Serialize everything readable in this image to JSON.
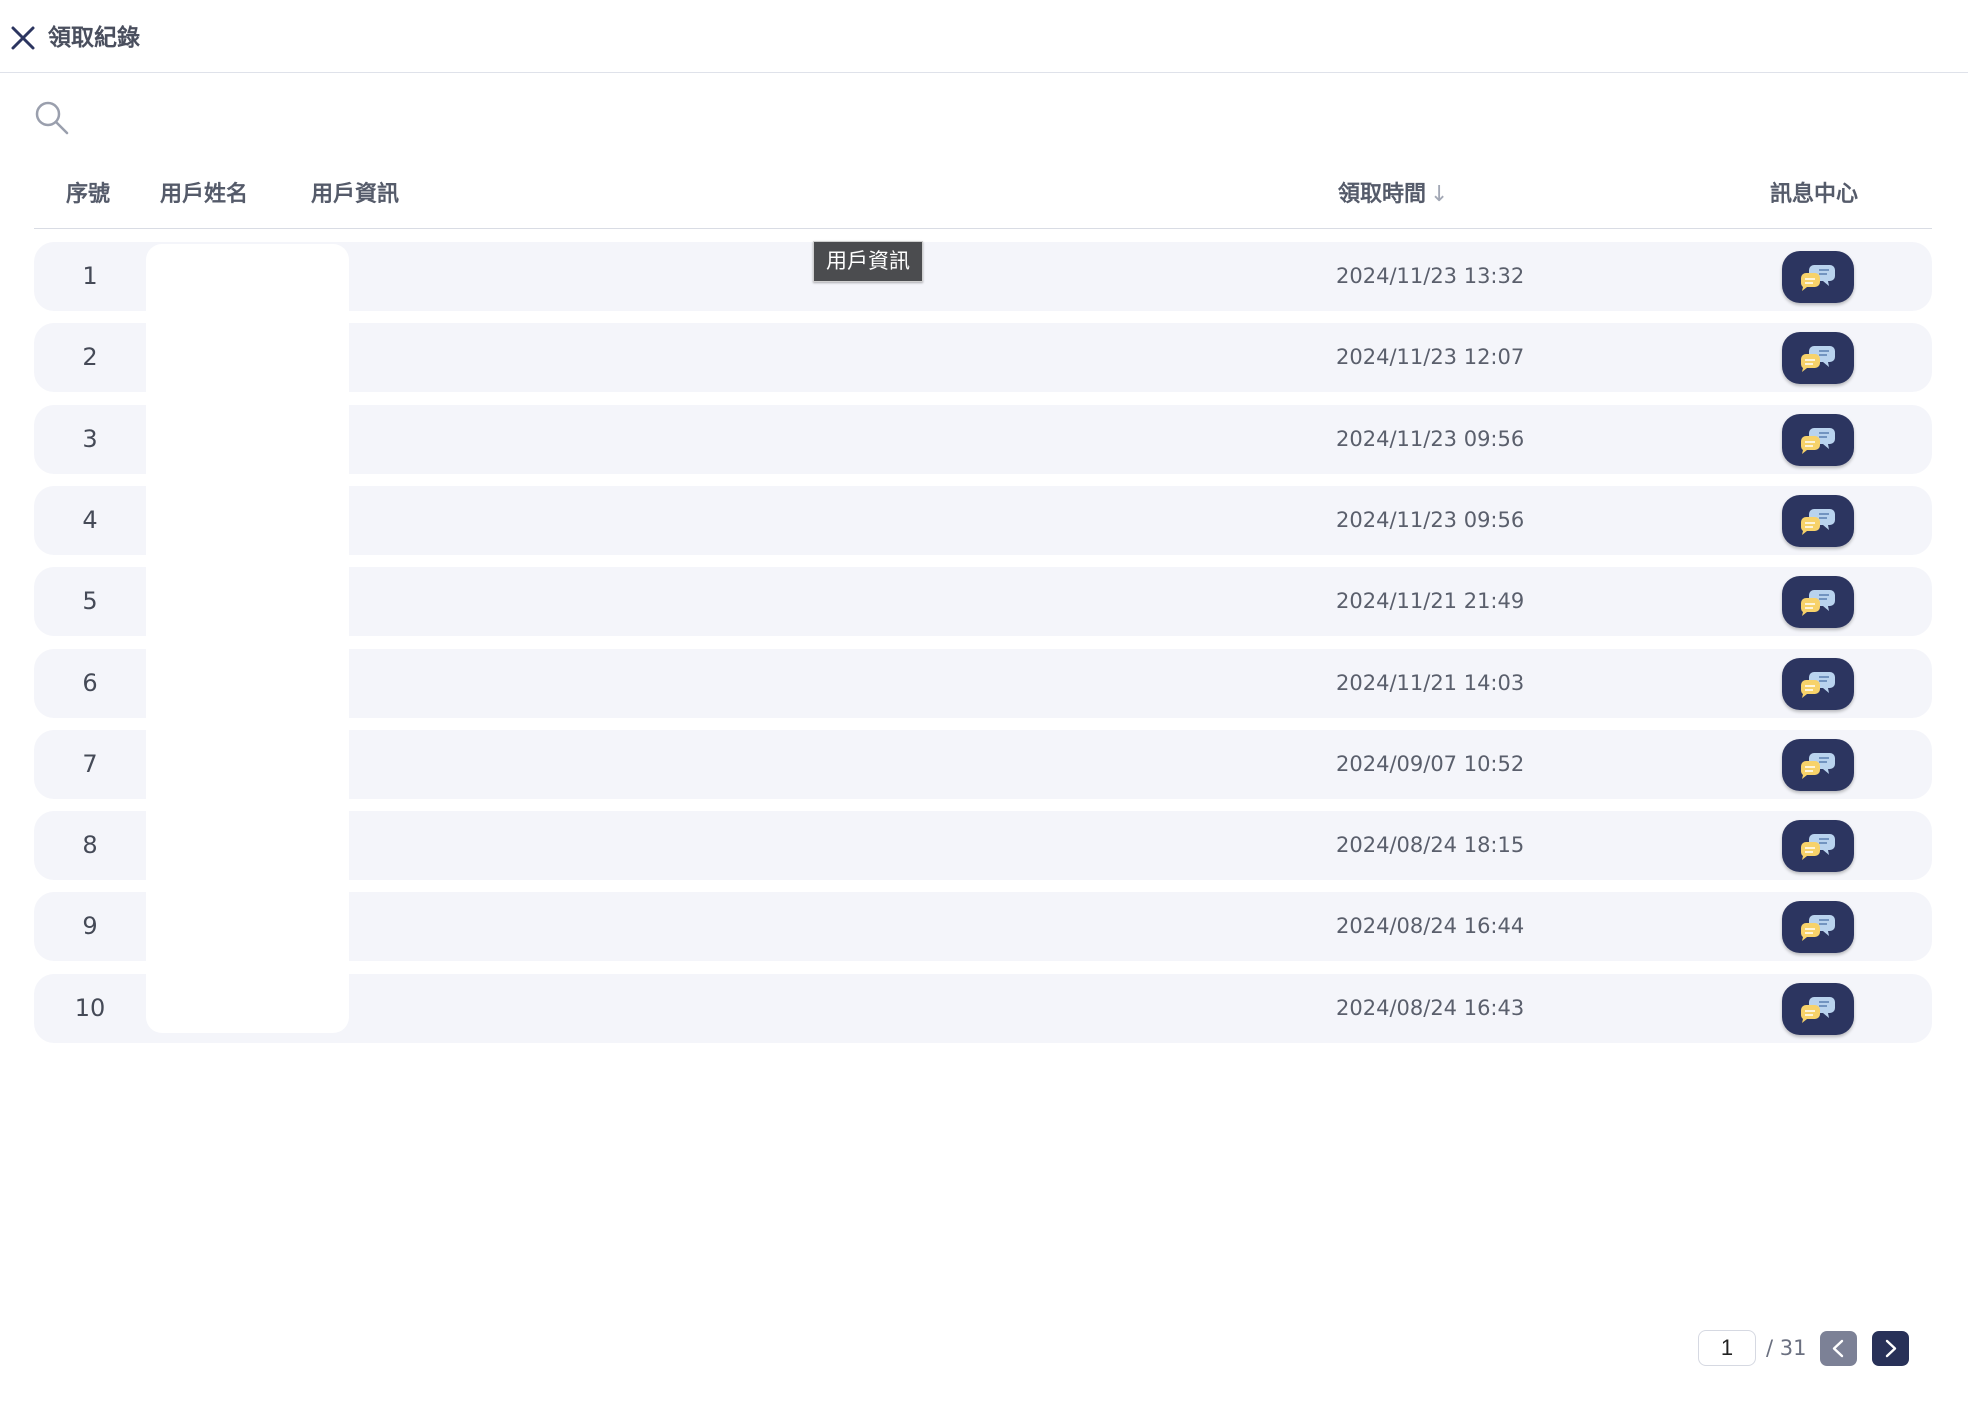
{
  "header": {
    "title": "領取紀錄",
    "close_icon": "close-icon"
  },
  "search": {
    "icon": "search-icon"
  },
  "table": {
    "columns": {
      "seq": "序號",
      "name": "用戶姓名",
      "info": "用戶資訊",
      "time": "領取時間",
      "time_sort": "↓",
      "message": "訊息中心"
    },
    "rows": [
      {
        "seq": "1",
        "time": "2024/11/23 13:32"
      },
      {
        "seq": "2",
        "time": "2024/11/23 12:07"
      },
      {
        "seq": "3",
        "time": "2024/11/23 09:56"
      },
      {
        "seq": "4",
        "time": "2024/11/23 09:56"
      },
      {
        "seq": "5",
        "time": "2024/11/21 21:49"
      },
      {
        "seq": "6",
        "time": "2024/11/21 14:03"
      },
      {
        "seq": "7",
        "time": "2024/09/07 10:52"
      },
      {
        "seq": "8",
        "time": "2024/08/24 18:15"
      },
      {
        "seq": "9",
        "time": "2024/08/24 16:44"
      },
      {
        "seq": "10",
        "time": "2024/08/24 16:43"
      }
    ]
  },
  "tooltip": {
    "text": "用戶資訊"
  },
  "pagination": {
    "current": "1",
    "total": "/ 31"
  },
  "colors": {
    "accent": "#2c3560",
    "row_bg": "#f4f5fa",
    "prev_button": "#7c8196"
  }
}
